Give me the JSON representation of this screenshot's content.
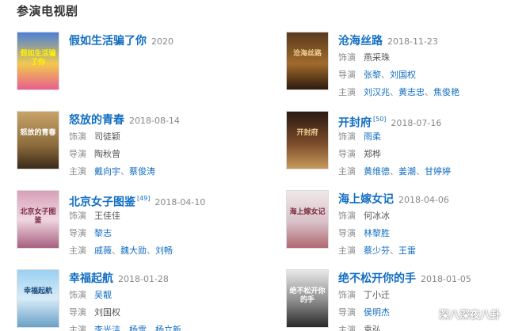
{
  "section_title": "参演电视剧",
  "ui": {
    "sep": "、"
  },
  "works": [
    {
      "title": "假如生活骗了你",
      "year": "2020",
      "poster_text": "假如生活骗了你",
      "roles": []
    },
    {
      "title": "沧海丝路",
      "year": "2018-11-23",
      "poster_text": "沧海丝路",
      "roles": [
        {
          "label": "饰演",
          "plain": "燕采珠"
        },
        {
          "label": "导演",
          "links": [
            "张黎",
            "刘国权"
          ]
        },
        {
          "label": "主演",
          "links": [
            "刘汉兆",
            "黄志忠",
            "焦俊艳"
          ]
        }
      ]
    },
    {
      "title": "怒放的青春",
      "year": "2018-08-14",
      "poster_text": "怒放的青春",
      "roles": [
        {
          "label": "饰演",
          "plain": "司徒颖"
        },
        {
          "label": "导演",
          "plain": "陶秋曾"
        },
        {
          "label": "主演",
          "links": [
            "戴向宇",
            "蔡俊涛"
          ]
        }
      ]
    },
    {
      "title": "开封府",
      "ref": "[50]",
      "year": "2018-07-16",
      "poster_text": "开封府",
      "roles": [
        {
          "label": "饰演",
          "links": [
            "雨柔"
          ]
        },
        {
          "label": "导演",
          "plain": "郑桦"
        },
        {
          "label": "主演",
          "links": [
            "黄维德",
            "姜潮",
            "甘婷婷"
          ]
        }
      ]
    },
    {
      "title": "北京女子图鉴",
      "ref": "[49]",
      "year": "2018-04-10",
      "poster_text": "北京女子图鉴",
      "roles": [
        {
          "label": "饰演",
          "plain": "王佳佳"
        },
        {
          "label": "导演",
          "links": [
            "黎志"
          ]
        },
        {
          "label": "主演",
          "links": [
            "戚薇",
            "魏大勋",
            "刘畅"
          ]
        }
      ]
    },
    {
      "title": "海上嫁女记",
      "year": "2018-04-06",
      "poster_text": "海上嫁女记",
      "roles": [
        {
          "label": "饰演",
          "plain": "何冰冰"
        },
        {
          "label": "导演",
          "links": [
            "林黎胜"
          ]
        },
        {
          "label": "主演",
          "links": [
            "蔡少芬",
            "王雷"
          ]
        }
      ]
    },
    {
      "title": "幸福起航",
      "year": "2018-01-28",
      "poster_text": "幸福起航",
      "roles": [
        {
          "label": "饰演",
          "links": [
            "吴靓"
          ]
        },
        {
          "label": "导演",
          "plain": "刘国权"
        },
        {
          "label": "主演",
          "links": [
            "李光洁",
            "杨雪",
            "杨立新"
          ]
        }
      ]
    },
    {
      "title": "绝不松开你的手",
      "year": "2018-01-05",
      "poster_text": "绝不松开你的手",
      "roles": [
        {
          "label": "饰演",
          "plain": "丁小迁"
        },
        {
          "label": "导演",
          "links": [
            "侯明杰"
          ]
        },
        {
          "label": "主演",
          "plain": "袁弘"
        }
      ]
    }
  ],
  "watermark": {
    "text": "深八深夜八卦",
    "icon": "wechat-icon"
  }
}
